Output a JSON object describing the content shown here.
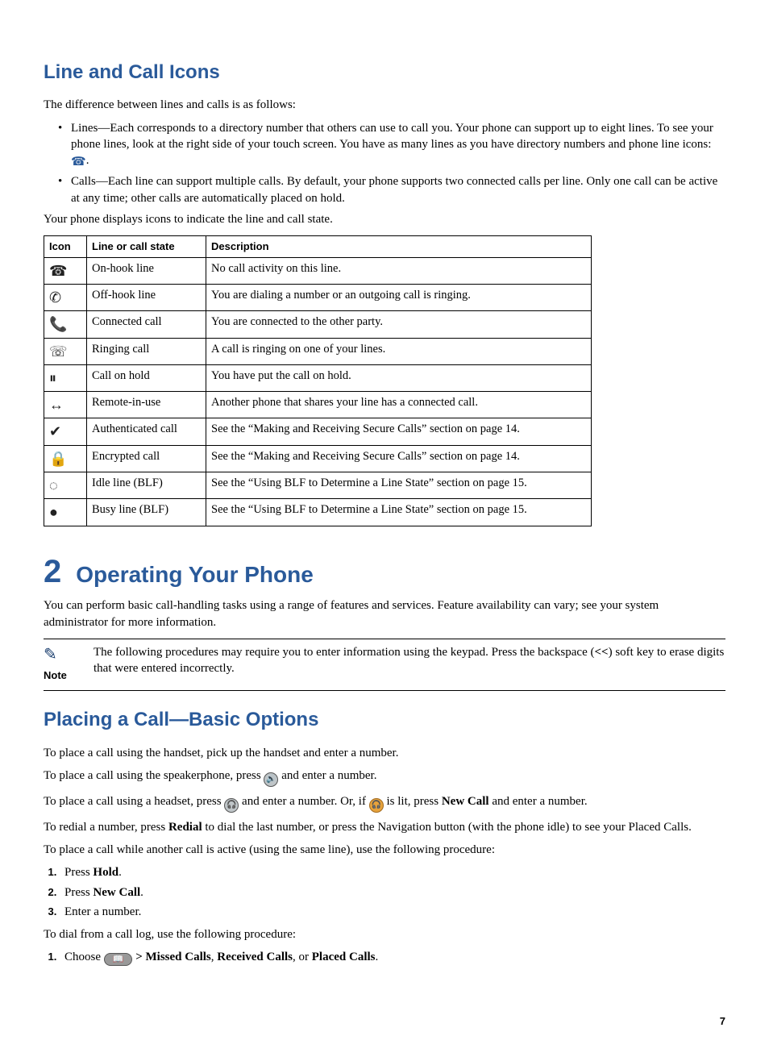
{
  "section1": {
    "title": "Line and Call Icons",
    "intro": "The difference between lines and calls is as follows:",
    "bullets": [
      "Lines—Each corresponds to a directory number that others can use to call you. Your phone can support up to eight lines. To see your phone lines, look at the right side of your touch screen. You have as many lines as you have directory numbers and phone line icons: ",
      "Calls—Each line can support multiple calls. By default, your phone supports two connected calls per line. Only one call can be active at any time; other calls are automatically placed on hold."
    ],
    "lead": "Your phone displays icons to indicate the line and call state.",
    "table": {
      "h1": "Icon",
      "h2": "Line or call state",
      "h3": "Description",
      "rows": [
        {
          "icon": "☎",
          "state": "On-hook line",
          "desc": "No call activity on this line."
        },
        {
          "icon": "✆",
          "state": "Off-hook line",
          "desc": "You are dialing a number or an outgoing call is ringing."
        },
        {
          "icon": "📞",
          "state": "Connected call",
          "desc": "You are connected to the other party."
        },
        {
          "icon": "☏",
          "state": "Ringing call",
          "desc": "A call is ringing on one of your lines."
        },
        {
          "icon": "⏸",
          "state": "Call on hold",
          "desc": "You have put the call on hold."
        },
        {
          "icon": "↔",
          "state": "Remote-in-use",
          "desc": "Another phone that shares your line has a connected call."
        },
        {
          "icon": "✔",
          "state": "Authenticated call",
          "desc": "See the “Making and Receiving Secure Calls” section on page 14."
        },
        {
          "icon": "🔒",
          "state": "Encrypted call",
          "desc": "See the “Making and Receiving Secure Calls” section on page 14."
        },
        {
          "icon": "◌",
          "state": "Idle line (BLF)",
          "desc": "See the “Using BLF to Determine a Line State” section on page 15."
        },
        {
          "icon": "●",
          "state": "Busy line (BLF)",
          "desc": "See the “Using BLF to Determine a Line State” section on page 15."
        }
      ]
    }
  },
  "chapter": {
    "num": "2",
    "title": "Operating Your Phone",
    "intro": "You can perform basic call-handling tasks using a range of features and services. Feature availability can vary; see your system administrator for more information.",
    "note_label": "Note",
    "note_body_a": "The following procedures may require you to enter information using the keypad. Press the backspace (",
    "note_body_bold": "<<",
    "note_body_b": ") soft key to erase digits that were entered incorrectly."
  },
  "section2": {
    "title": "Placing a Call—Basic Options",
    "p1": "To place a call using the handset, pick up the handset and enter a number.",
    "p2a": "To place a call using the speakerphone, press ",
    "p2b": " and enter a number.",
    "p3a": "To place a call using a headset, press ",
    "p3b": " and enter a number. Or, if ",
    "p3c": " is lit, press ",
    "p3bold": "New Call",
    "p3d": " and enter a number.",
    "p4a": "To redial a number, press ",
    "p4bold": "Redial",
    "p4b": " to dial the last number, or press the Navigation button (with the phone idle) to see your Placed Calls.",
    "p5": "To place a call while another call is active (using the same line), use the following procedure:",
    "steps1": [
      {
        "pre": "Press ",
        "bold": "Hold",
        "post": "."
      },
      {
        "pre": "Press ",
        "bold": "New Call",
        "post": "."
      },
      {
        "pre": "Enter a number.",
        "bold": "",
        "post": ""
      }
    ],
    "p6": "To dial from a call log, use the following procedure:",
    "step2_pre": "Choose ",
    "step2_sym": "📖",
    "step2_gt": " > ",
    "step2_b1": "Missed Calls",
    "step2_c": ", ",
    "step2_b2": "Received Calls",
    "step2_or": ", or ",
    "step2_b3": "Placed Calls",
    "step2_end": "."
  },
  "page_num": "7"
}
